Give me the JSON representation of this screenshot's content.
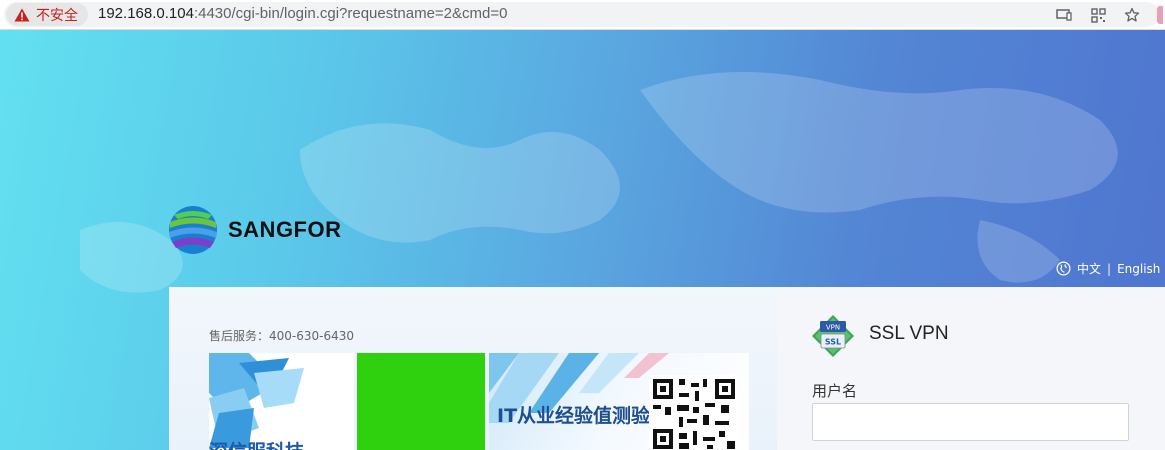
{
  "browser": {
    "security_label": "不安全",
    "url_host": "192.168.0.104",
    "url_path": ":4430/cgi-bin/login.cgi?requestname=2&cmd=0",
    "icons": [
      "cast-icon",
      "qr-code-icon",
      "bookmark-star-icon",
      "extension-icon"
    ]
  },
  "brand": {
    "name": "SANGFOR"
  },
  "language": {
    "zh": "中文",
    "separator": "|",
    "en": "English"
  },
  "left_panel": {
    "hotline": "售后服务：400-630-6430",
    "banner1_text": "深信服科技",
    "banner3_text": "IT从业经验值测验"
  },
  "login": {
    "icon_badge_top": "VPN",
    "icon_badge_bottom": "SSL",
    "title": "SSL VPN",
    "username_label": "用户名",
    "username_value": ""
  },
  "colors": {
    "warning": "#c5221f",
    "banner_green": "#2fd00e"
  }
}
